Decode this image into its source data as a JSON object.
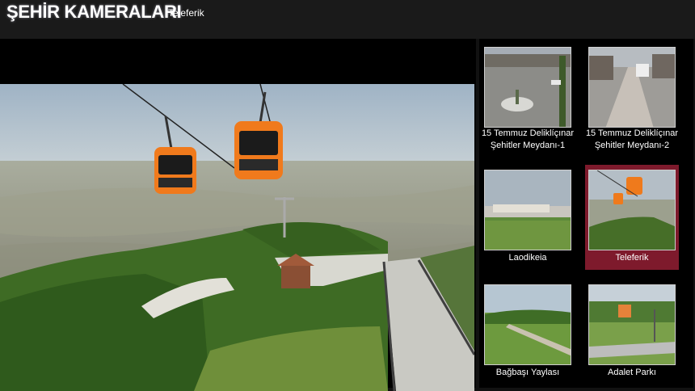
{
  "header": {
    "title": "ŞEHİR KAMERALARI",
    "subtitle": "Teleferik"
  },
  "player": {
    "camera": "Teleferik"
  },
  "cameras": [
    {
      "label": "15 Temmuz Deliklíçınar Şehitler Meydanı-1",
      "line1": "15 Temmuz Deliklíçınar",
      "line2": "Şehitler Meydanı-1",
      "active": false
    },
    {
      "label": "15 Temmuz Deliklíçınar Şehitler Meydanı-2",
      "line1": "15 Temmuz Deliklíçınar",
      "line2": "Şehitler Meydanı-2",
      "active": false
    },
    {
      "label": "Laodikeia",
      "line1": "Laodikeia",
      "active": false
    },
    {
      "label": "Teleferik",
      "line1": "Teleferik",
      "active": true
    },
    {
      "label": "Bağbaşı Yaylası",
      "line1": "Bağbaşı Yaylası",
      "active": false
    },
    {
      "label": "Adalet Parkı",
      "line1": "Adalet Parkı",
      "active": false
    }
  ],
  "colors": {
    "active_item": "#7e1a2c",
    "header_bg": "#1a1a1a",
    "page_bg": "#111111"
  }
}
